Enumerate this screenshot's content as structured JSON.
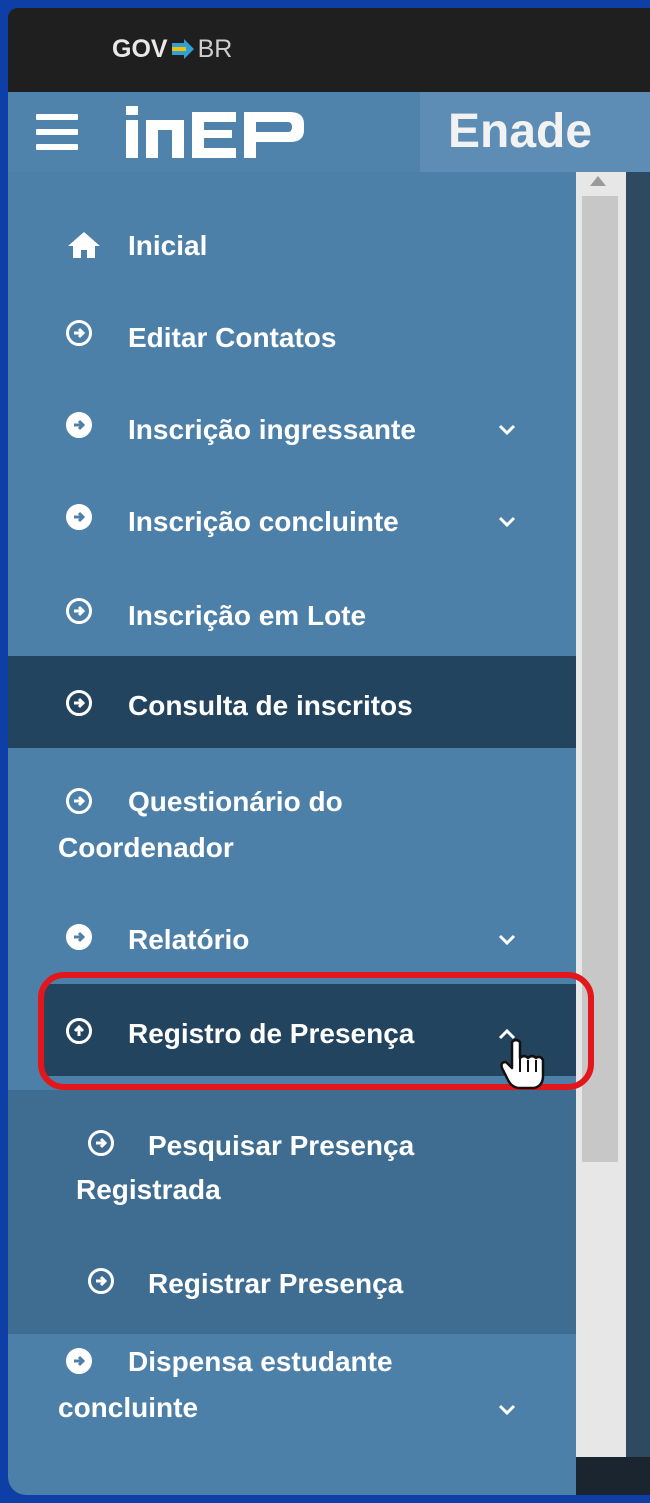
{
  "gov": {
    "gov_text": "GOV",
    "br_text": "BR"
  },
  "header": {
    "app_title": "Enade",
    "logo_text": "inep"
  },
  "sidebar": {
    "items": [
      {
        "label": "Inicial",
        "icon": "home-icon"
      },
      {
        "label": "Editar Contatos",
        "icon": "arrow-circle-right-icon"
      },
      {
        "label": "Inscrição ingressante",
        "icon": "arrow-circle-right-icon",
        "expandable": true
      },
      {
        "label": "Inscrição concluinte",
        "icon": "arrow-circle-right-icon",
        "expandable": true
      },
      {
        "label": "Inscrição em Lote",
        "icon": "arrow-circle-right-icon"
      },
      {
        "label": "Consulta de inscritos",
        "icon": "arrow-circle-right-icon",
        "active": true
      },
      {
        "label_line1": "Questionário do",
        "label_line2": "Coordenador",
        "icon": "arrow-circle-right-icon"
      },
      {
        "label": "Relatório",
        "icon": "arrow-circle-right-icon",
        "expandable": true
      },
      {
        "label": "Registro de Presença",
        "icon": "arrow-circle-up-icon",
        "expanded": true
      },
      {
        "label_line1": "Pesquisar Presença",
        "label_line2": "Registrada",
        "icon": "arrow-circle-right-icon",
        "submenu": true
      },
      {
        "label": "Registrar Presença",
        "icon": "arrow-circle-right-icon",
        "submenu": true
      },
      {
        "label_line1": "Dispensa estudante",
        "label_line2": "concluinte",
        "icon": "arrow-circle-right-icon",
        "expandable": true
      }
    ]
  },
  "colors": {
    "sidebar_bg": "#4d80a8",
    "active_bg": "#23445f",
    "highlight": "#e3161c",
    "outer_bg": "#0d3fa6"
  }
}
